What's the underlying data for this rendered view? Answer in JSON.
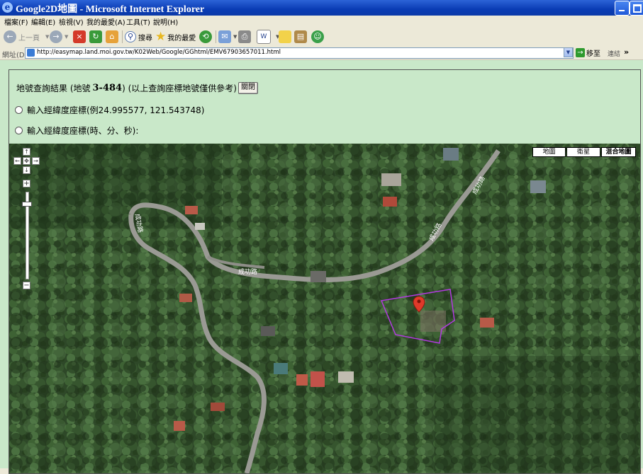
{
  "window": {
    "title": "Google2D地圖 - Microsoft Internet Explorer"
  },
  "menu": [
    "檔案(F)",
    "編輯(E)",
    "檢視(V)",
    "我的最愛(A)",
    "工具(T)",
    "說明(H)"
  ],
  "toolbar": {
    "back": "上一頁",
    "search": "搜尋",
    "favorites": "我的最愛"
  },
  "address": {
    "label": "網址(D)",
    "url": "http://easymap.land.moi.gov.tw/K02Web/Google/GGhtml/EMV67903657011.html",
    "go": "移至",
    "links": "連結"
  },
  "result": {
    "prefix": "地號查詢結果 (地號",
    "parcel": "3-484",
    "suffix": ") (以上查詢座標地號僅供參考)",
    "close": "關閉"
  },
  "options": [
    "輸入經緯度座標(例24.995577, 121.543748)",
    "輸入經緯度座標(時、分、秒):"
  ],
  "map": {
    "types": [
      "地圖",
      "衛星",
      "混合地圖"
    ],
    "active_type": "混合地圖",
    "road_labels": [
      "成功路",
      "成功路",
      "成功路",
      "成功路"
    ]
  },
  "colors": {
    "page_bg": "#C9E8C9",
    "boundary": "#B23AE0",
    "marker": "#E03A2A"
  }
}
